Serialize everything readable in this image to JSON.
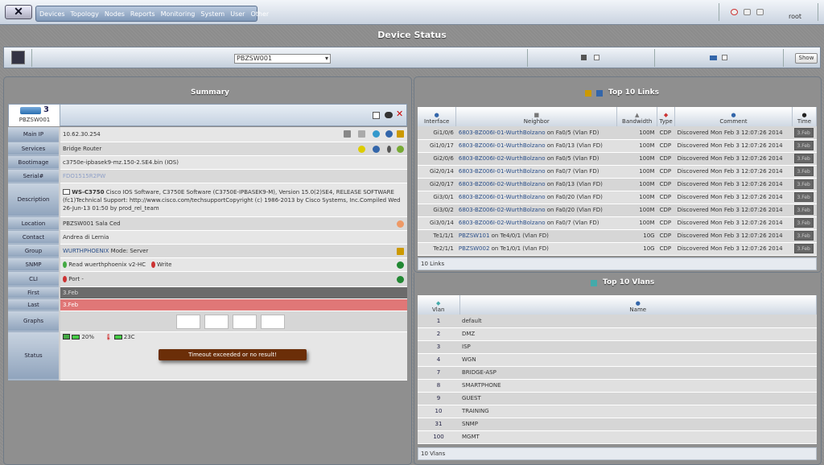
{
  "topbar": {
    "menu": [
      "Devices",
      "Topology",
      "Nodes",
      "Reports",
      "Monitoring",
      "System",
      "User",
      "Other"
    ],
    "user": "root"
  },
  "page_title": "Device Status",
  "controls": {
    "device": "PBZSW001",
    "show_label": "Show"
  },
  "summary": {
    "title": "Summary",
    "device_name": "PBZSW001",
    "device_count": "3",
    "rows": [
      {
        "label": "Main IP",
        "value": "10.62.30.254"
      },
      {
        "label": "Services",
        "value": "Bridge Router"
      },
      {
        "label": "Bootimage",
        "value": "c3750e-ipbasek9-mz.150-2.SE4.bin (IOS)"
      },
      {
        "label": "Serial#",
        "value": "FDO1515R2PW"
      },
      {
        "label": "Description",
        "value_bold": "WS-C3750",
        "value": " Cisco IOS Software, C3750E Software (C3750E-IPBASEK9-M), Version 15.0(2)SE4, RELEASE SOFTWARE (fc1)Technical Support: http://www.cisco.com/techsupportCopyright (c) 1986-2013 by Cisco Systems, Inc.Compiled Wed 26-Jun-13 01:50 by prod_rel_team"
      },
      {
        "label": "Location",
        "value": "PBZSW001 Sala Ced"
      },
      {
        "label": "Contact",
        "value": "Andrea di Lernia"
      },
      {
        "label": "Group",
        "value_link": "WURTHPHOENIX",
        "value": " Mode: Server"
      },
      {
        "label": "SNMP",
        "value": "Read wuerthphoenix v2-HC",
        "value2": "Write"
      },
      {
        "label": "CLI",
        "value": "Port -"
      },
      {
        "label": "First",
        "value": "3.Feb"
      },
      {
        "label": "Last",
        "value": "3.Feb"
      },
      {
        "label": "Graphs",
        "value": ""
      },
      {
        "label": "Status",
        "cpu": "20%",
        "temp": "23C",
        "error": "Timeout exceeded or no result!"
      }
    ]
  },
  "links": {
    "title": "Top 10 Links",
    "headers": [
      "Interface",
      "Neighbor",
      "Bandwidth",
      "Type",
      "Comment",
      "Time"
    ],
    "rows": [
      {
        "iface": "Gi1/0/6",
        "neighbor": "6803-BZ006I-01-WurthBolzano",
        "on": " on Fa0/5 (Vlan FD)",
        "bw": "100M",
        "type": "CDP",
        "comment": "Discovered Mon Feb 3 12:07:26 2014",
        "time": "3.Feb"
      },
      {
        "iface": "Gi1/0/17",
        "neighbor": "6803-BZ006I-01-WurthBolzano",
        "on": " on Fa0/13 (Vlan FD)",
        "bw": "100M",
        "type": "CDP",
        "comment": "Discovered Mon Feb 3 12:07:26 2014",
        "time": "3.Feb"
      },
      {
        "iface": "Gi2/0/6",
        "neighbor": "6803-BZ006I-02-WurthBolzano",
        "on": " on Fa0/5 (Vlan FD)",
        "bw": "100M",
        "type": "CDP",
        "comment": "Discovered Mon Feb 3 12:07:26 2014",
        "time": "3.Feb"
      },
      {
        "iface": "Gi2/0/14",
        "neighbor": "6803-BZ006I-01-WurthBolzano",
        "on": " on Fa0/7 (Vlan FD)",
        "bw": "100M",
        "type": "CDP",
        "comment": "Discovered Mon Feb 3 12:07:26 2014",
        "time": "3.Feb"
      },
      {
        "iface": "Gi2/0/17",
        "neighbor": "6803-BZ006I-02-WurthBolzano",
        "on": " on Fa0/13 (Vlan FD)",
        "bw": "100M",
        "type": "CDP",
        "comment": "Discovered Mon Feb 3 12:07:26 2014",
        "time": "3.Feb"
      },
      {
        "iface": "Gi3/0/1",
        "neighbor": "6803-BZ006I-01-WurthBolzano",
        "on": " on Fa0/20 (Vlan FD)",
        "bw": "100M",
        "type": "CDP",
        "comment": "Discovered Mon Feb 3 12:07:26 2014",
        "time": "3.Feb"
      },
      {
        "iface": "Gi3/0/2",
        "neighbor": "6803-BZ006I-02-WurthBolzano",
        "on": " on Fa0/20 (Vlan FD)",
        "bw": "100M",
        "type": "CDP",
        "comment": "Discovered Mon Feb 3 12:07:26 2014",
        "time": "3.Feb"
      },
      {
        "iface": "Gi3/0/14",
        "neighbor": "6803-BZ006I-02-WurthBolzano",
        "on": " on Fa0/7 (Vlan FD)",
        "bw": "100M",
        "type": "CDP",
        "comment": "Discovered Mon Feb 3 12:07:26 2014",
        "time": "3.Feb"
      },
      {
        "iface": "Te1/1/1",
        "neighbor": "PBZSW101",
        "on": " on Te4/0/1 (Vlan FD)",
        "bw": "10G",
        "type": "CDP",
        "comment": "Discovered Mon Feb 3 12:07:26 2014",
        "time": "3.Feb"
      },
      {
        "iface": "Te2/1/1",
        "neighbor": "PBZSW002",
        "on": " on Te1/0/1 (Vlan FD)",
        "bw": "10G",
        "type": "CDP",
        "comment": "Discovered Mon Feb 3 12:07:26 2014",
        "time": "3.Feb"
      }
    ],
    "footer": "10 Links"
  },
  "vlans": {
    "title": "Top 10 Vlans",
    "headers": [
      "Vlan",
      "Name"
    ],
    "rows": [
      {
        "id": "1",
        "name": "default"
      },
      {
        "id": "2",
        "name": "DMZ"
      },
      {
        "id": "3",
        "name": "ISP"
      },
      {
        "id": "4",
        "name": "WGN"
      },
      {
        "id": "7",
        "name": "BRIDGE-ASP"
      },
      {
        "id": "8",
        "name": "SMARTPHONE"
      },
      {
        "id": "9",
        "name": "GUEST"
      },
      {
        "id": "10",
        "name": "TRAINING"
      },
      {
        "id": "31",
        "name": "SNMP"
      },
      {
        "id": "100",
        "name": "MGMT"
      }
    ],
    "footer": "10 Vlans"
  },
  "colors": {
    "first_row": "#6b6b6b",
    "last_row": "#e07777",
    "error_bg": "#6b2e08"
  }
}
